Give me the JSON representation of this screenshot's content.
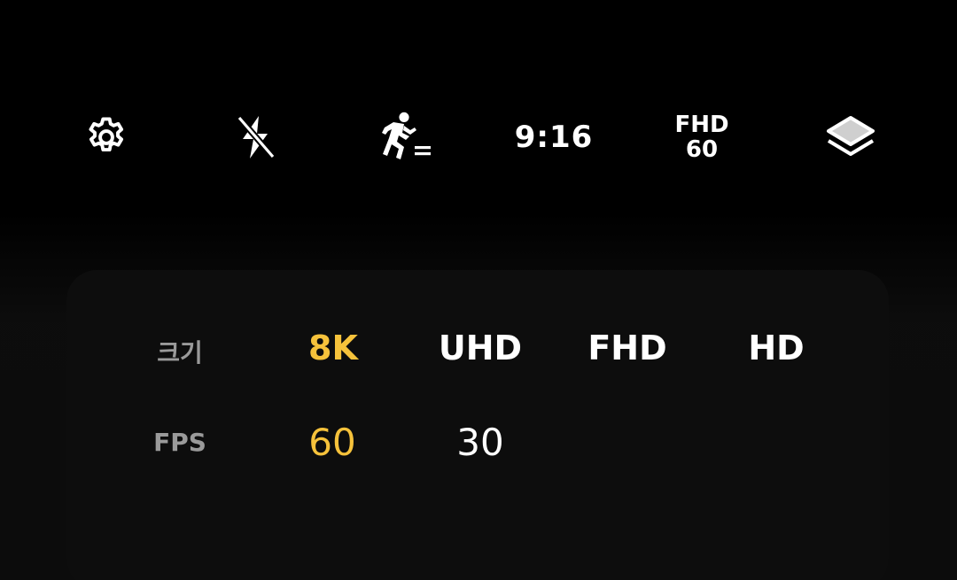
{
  "toolbar": {
    "settings_icon": "gear-icon",
    "flash_icon": "flash-off-icon",
    "motion_icon": "running-person-icon",
    "aspect_ratio": "9:16",
    "quality_line1": "FHD",
    "quality_line2": "60",
    "layers_icon": "layers-icon"
  },
  "resolution_panel": {
    "size_label": "크기",
    "size_options": [
      "8K",
      "UHD",
      "FHD",
      "HD"
    ],
    "selected_size": "8K",
    "fps_label": "FPS",
    "fps_options": [
      "60",
      "30"
    ],
    "selected_fps": "60"
  },
  "colors": {
    "background": "#000000",
    "panel": "#0d0d0d",
    "accent": "#f6c23b",
    "label_gray": "#9a9a9a",
    "text": "#ffffff"
  }
}
